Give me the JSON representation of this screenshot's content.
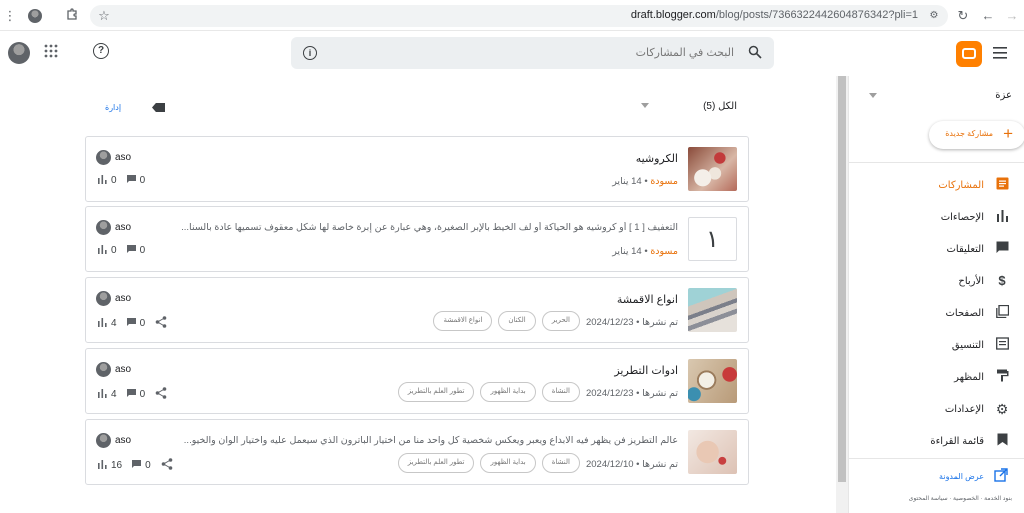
{
  "browser": {
    "url_host": "draft.blogger.com",
    "url_path": "/blog/posts/7366322442604876342?pli=1"
  },
  "header": {
    "search_placeholder": "البحث في المشاركات"
  },
  "list": {
    "filter_label": "الكل (5)",
    "manage_label": "إدارة"
  },
  "posts": [
    {
      "title": "الكروشيه",
      "snippet": "",
      "status": "مسودة",
      "date": "14 يناير",
      "labels": [],
      "author": "aso",
      "views": "0",
      "comments": "0",
      "share": false,
      "thumb": "crochet"
    },
    {
      "title": "",
      "snippet": "التعفيف [ 1 ] أو كروشيه هو الحياكة أو لف الخيط بالإبر الصغيرة، وهي عبارة عن إبرة خاصة لها شكل معقوف تسميها عادة بالسنا...",
      "status": "مسودة",
      "date": "14 يناير",
      "labels": [],
      "author": "aso",
      "views": "0",
      "comments": "0",
      "share": false,
      "thumb": "number",
      "thumb_text": "١"
    },
    {
      "title": "انواع الاقمشة",
      "snippet": "",
      "status": "تم نشرها",
      "date": "2024/12/23",
      "labels": [
        "الحرير",
        "الكتان",
        "انواع الاقمشة"
      ],
      "author": "aso",
      "views": "4",
      "comments": "0",
      "share": true,
      "thumb": "fabric"
    },
    {
      "title": "ادوات التطريز",
      "snippet": "",
      "status": "تم نشرها",
      "date": "2024/12/23",
      "labels": [
        "النشاة",
        "بداية الظهور",
        "تطور العلم بالتطريز"
      ],
      "author": "aso",
      "views": "4",
      "comments": "0",
      "share": true,
      "thumb": "tools"
    },
    {
      "title": "",
      "snippet": "عالم التطريز فن يظهر فيه الابداع ويعبر ويعكس شخصية كل واحد منا من اختيار الباترون الذي سيعمل عليه واختيار الوان والخيو...",
      "status": "تم نشرها",
      "date": "2024/12/10",
      "labels": [
        "النشاة",
        "بداية الظهور",
        "تطور العلم بالتطريز"
      ],
      "author": "aso",
      "views": "16",
      "comments": "0",
      "share": true,
      "thumb": "hand"
    }
  ],
  "sidebar": {
    "blog_name": "عزة",
    "new_post": "مشاركة جديدة",
    "items": [
      {
        "label": "المشاركات",
        "icon": "posts-icon",
        "active": true
      },
      {
        "label": "الإحصاءات",
        "icon": "stats-icon",
        "active": false
      },
      {
        "label": "التعليقات",
        "icon": "comments-icon",
        "active": false
      },
      {
        "label": "الأرباح",
        "icon": "dollar-icon",
        "active": false
      },
      {
        "label": "الصفحات",
        "icon": "pages-icon",
        "active": false
      },
      {
        "label": "التنسيق",
        "icon": "layout-icon",
        "active": false
      },
      {
        "label": "المظهر",
        "icon": "theme-icon",
        "active": false
      },
      {
        "label": "الإعدادات",
        "icon": "gear-icon",
        "active": false
      },
      {
        "label": "قائمة القراءة",
        "icon": "bookmark-icon",
        "active": false
      }
    ],
    "view_blog": "عرض المدونة",
    "footer": "بنود الخدمة · الخصوصية · سياسة المحتوى"
  },
  "colors": {
    "accent": "#e8710a",
    "view_blog": "#1a73e8"
  }
}
